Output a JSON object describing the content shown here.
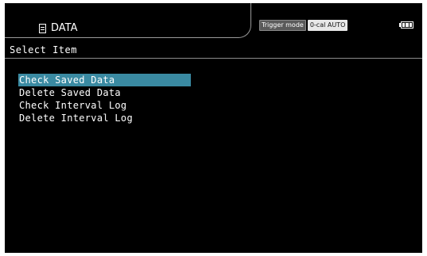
{
  "header": {
    "title": "DATA",
    "title_icon": "document-icon",
    "trigger_mode": "Trigger mode",
    "ocal_mode": "0-cal AUTO",
    "battery_icon": "battery-icon",
    "battery_level": 1.0
  },
  "section": {
    "title": "Select Item"
  },
  "menu": {
    "selected_index": 0,
    "items": [
      {
        "label": "Check Saved Data"
      },
      {
        "label": "Delete Saved Data"
      },
      {
        "label": "Check Interval Log"
      },
      {
        "label": "Delete Interval Log"
      }
    ]
  },
  "colors": {
    "background": "#000000",
    "text": "#ffffff",
    "highlight": "#3a8aa2",
    "divider": "#8c8c8c"
  }
}
